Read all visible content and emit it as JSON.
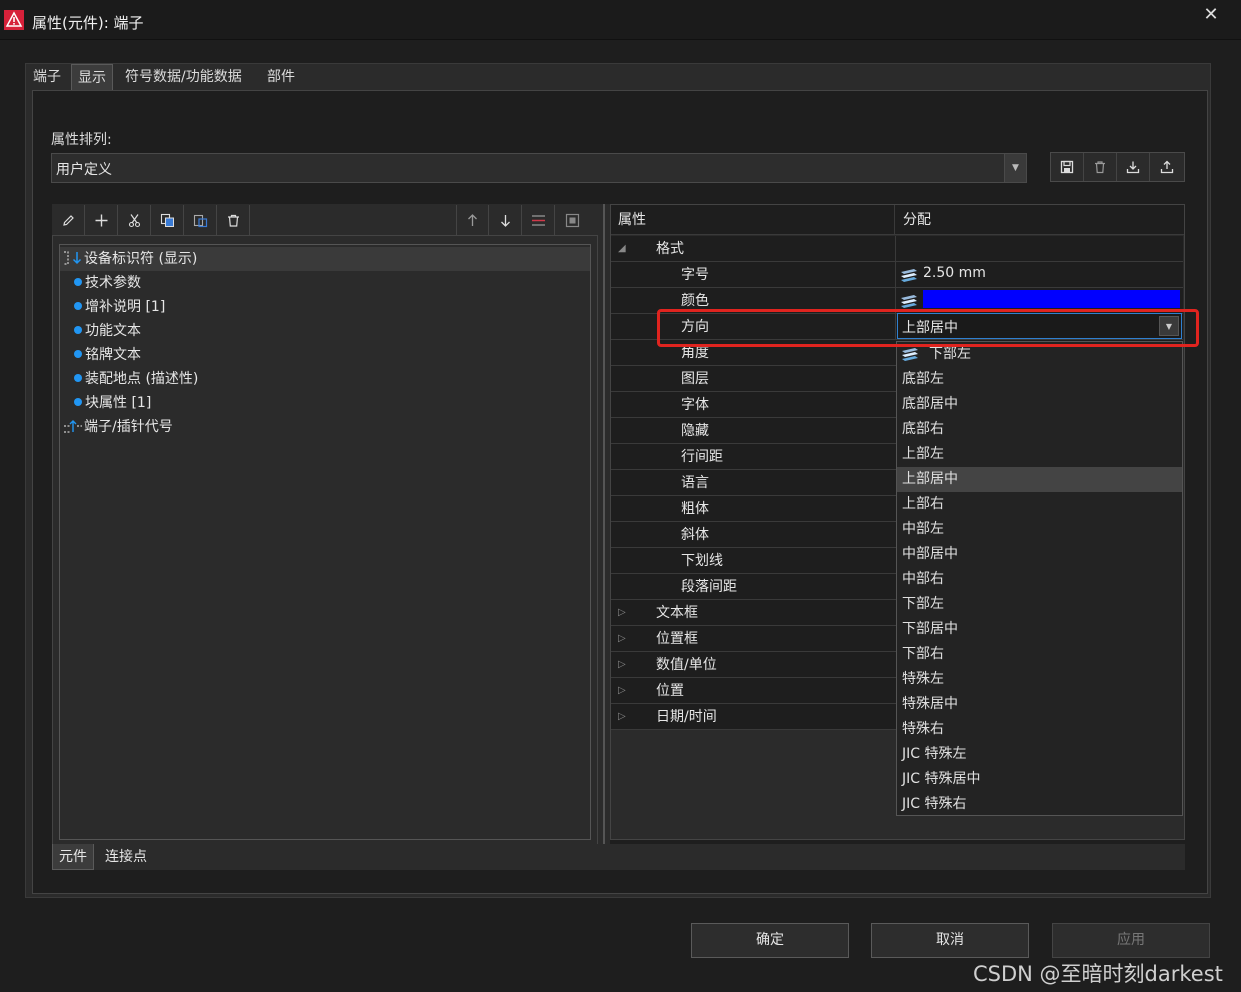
{
  "window": {
    "title": "属性(元件): 端子",
    "close_symbol": "✕"
  },
  "tabs": [
    "端子",
    "显示",
    "符号数据/功能数据",
    "部件"
  ],
  "property_arrangement": {
    "label": "属性排列:",
    "value": "用户定义"
  },
  "tree": {
    "items": [
      {
        "label": "设备标识符 (显示)",
        "kind": "root"
      },
      {
        "label": "技术参数",
        "kind": "child"
      },
      {
        "label": "增补说明 [1]",
        "kind": "child"
      },
      {
        "label": "功能文本",
        "kind": "child"
      },
      {
        "label": "铭牌文本",
        "kind": "child"
      },
      {
        "label": "装配地点 (描述性)",
        "kind": "child"
      },
      {
        "label": "块属性 [1]",
        "kind": "child"
      },
      {
        "label": "端子/插针代号",
        "kind": "root2"
      }
    ]
  },
  "grid": {
    "header_property": "属性",
    "header_value": "分配",
    "rows": [
      {
        "name": "格式",
        "group": true,
        "expanded": true
      },
      {
        "name": "字号",
        "value": "2.50 mm"
      },
      {
        "name": "颜色",
        "color": "#0000ff"
      },
      {
        "name": "方向",
        "value": "上部居中"
      },
      {
        "name": "角度"
      },
      {
        "name": "图层"
      },
      {
        "name": "字体"
      },
      {
        "name": "隐藏"
      },
      {
        "name": "行间距"
      },
      {
        "name": "语言"
      },
      {
        "name": "粗体"
      },
      {
        "name": "斜体"
      },
      {
        "name": "下划线"
      },
      {
        "name": "段落间距"
      },
      {
        "name": "文本框",
        "group": true
      },
      {
        "name": "位置框",
        "group": true
      },
      {
        "name": "数值/单位",
        "group": true
      },
      {
        "name": "位置",
        "group": true
      },
      {
        "name": "日期/时间",
        "group": true
      }
    ]
  },
  "direction_dropdown": {
    "selected": "上部居中",
    "options": [
      "下部左",
      "底部左",
      "底部居中",
      "底部右",
      "上部左",
      "上部居中",
      "上部右",
      "中部左",
      "中部居中",
      "中部右",
      "下部左",
      "下部居中",
      "下部右",
      "特殊左",
      "特殊居中",
      "特殊右",
      "JIC 特殊左",
      "JIC 特殊居中",
      "JIC 特殊右"
    ]
  },
  "bottom_tabs": [
    "元件",
    "连接点"
  ],
  "buttons": {
    "ok": "确定",
    "cancel": "取消",
    "apply": "应用"
  },
  "watermark": "CSDN @至暗时刻darkest",
  "colors": {
    "accent": "#2196f3",
    "highlight_box": "#e0241f",
    "color_swatch": "#0000ff"
  }
}
